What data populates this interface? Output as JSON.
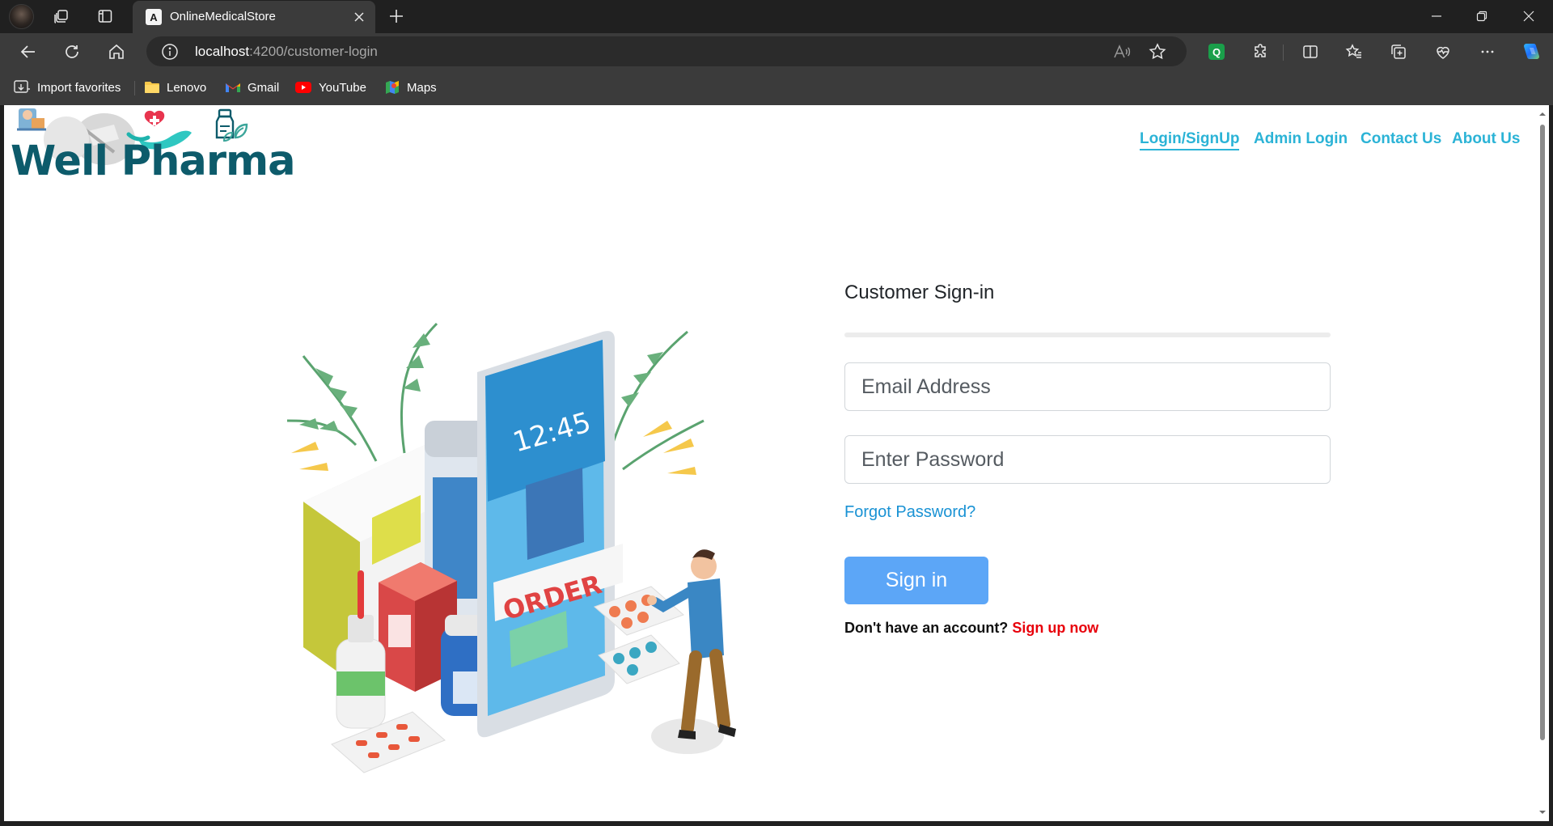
{
  "browser": {
    "tab_title": "OnlineMedicalStore",
    "tab_favicon": "A",
    "url_host": "localhost",
    "url_path": ":4200/customer-login",
    "favorites": [
      {
        "label": "Import favorites",
        "icon": "import-icon"
      },
      {
        "label": "Lenovo",
        "icon": "folder-icon"
      },
      {
        "label": "Gmail",
        "icon": "gmail-icon"
      },
      {
        "label": "YouTube",
        "icon": "youtube-icon"
      },
      {
        "label": "Maps",
        "icon": "maps-icon"
      }
    ],
    "extension_label": "Q"
  },
  "site": {
    "logo_text": "Well Pharma",
    "nav": {
      "login_signup": "Login/SignUp",
      "admin_login": "Admin Login",
      "contact_us": "Contact Us",
      "about_us": "About Us"
    },
    "illustration": {
      "phone_time": "12:45",
      "order_label": "ORDER"
    }
  },
  "login": {
    "title": "Customer Sign-in",
    "email_placeholder": "Email Address",
    "email_value": "",
    "password_placeholder": "Enter Password",
    "password_value": "",
    "forgot_password": "Forgot Password?",
    "sign_in_label": "Sign in",
    "no_account_text": "Don't have an account?",
    "sign_up_link": "Sign up now"
  },
  "colors": {
    "accent_link": "#2bb3d6",
    "button": "#5ca6f7",
    "signup_red": "#e8000b",
    "logo_teal": "#0d5b6b"
  }
}
